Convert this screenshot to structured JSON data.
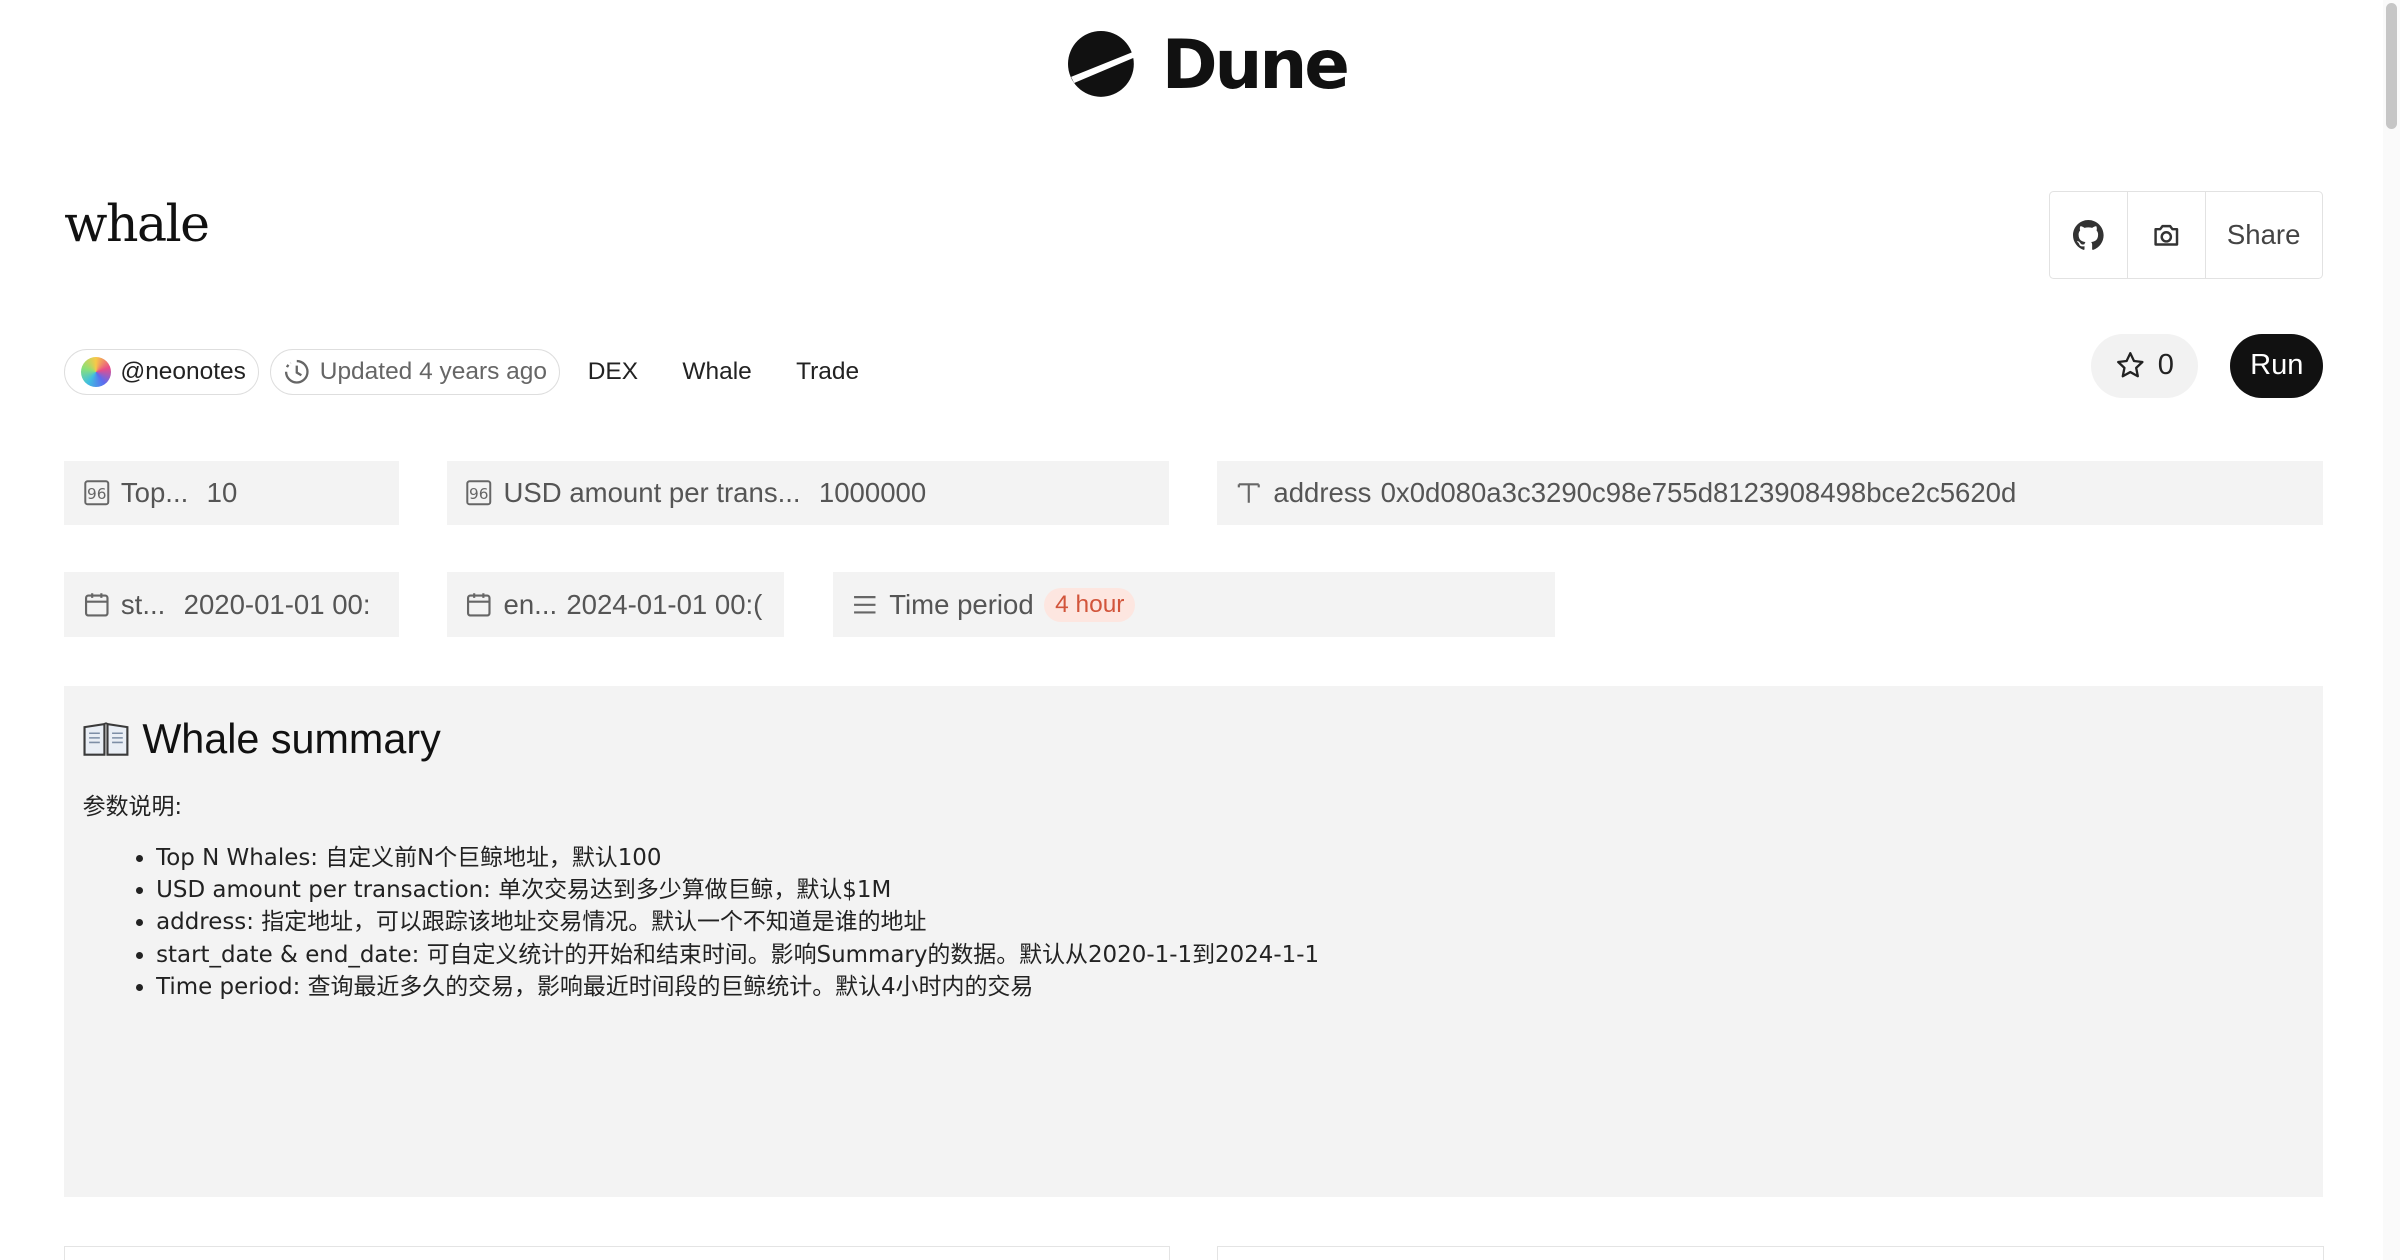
{
  "brand": {
    "name": "Dune"
  },
  "page": {
    "title": "whale"
  },
  "toolbar": {
    "share_label": "Share"
  },
  "meta": {
    "author": "@neonotes",
    "updated": "Updated 4 years ago",
    "tags": [
      "DEX",
      "Whale",
      "Trade"
    ],
    "stars": "0",
    "run_label": "Run"
  },
  "params": {
    "top": {
      "name": "Top...",
      "value": "10"
    },
    "usd": {
      "name": "USD amount per trans...",
      "value": "1000000"
    },
    "address": {
      "name": "address",
      "value": "0x0d080a3c3290c98e755d8123908498bce2c5620d"
    },
    "start": {
      "name": "st...",
      "value": "2020-01-01 00:"
    },
    "end": {
      "name": "en...",
      "value": "2024-01-01 00:("
    },
    "period": {
      "name": "Time period",
      "value": "4 hour"
    }
  },
  "summary": {
    "heading": "Whale summary",
    "subtitle": "参数说明:",
    "items": [
      "Top N Whales: 自定义前N个巨鲸地址，默认100",
      "USD amount per transaction: 单次交易达到多少算做巨鲸，默认$1M",
      "address: 指定地址，可以跟踪该地址交易情况。默认一个不知道是谁的地址",
      "start_date & end_date: 可自定义统计的开始和结束时间。影响Summary的数据。默认从2020-1-1到2024-1-1",
      "Time period: 查询最近多久的交易，影响最近时间段的巨鲸统计。默认4小时内的交易"
    ]
  },
  "colors": {
    "accent_badge_bg": "#fde6e0",
    "accent_badge_text": "#d2553b",
    "run_bg": "#111111"
  },
  "icons": {
    "logo": "dune-logo-icon",
    "github": "github-icon",
    "camera": "camera-icon",
    "star": "star-icon",
    "updated": "clock-history-icon",
    "percent": "percent-box-icon",
    "text": "text-type-icon",
    "calendar": "calendar-icon",
    "list": "list-icon",
    "book": "open-book-icon"
  }
}
